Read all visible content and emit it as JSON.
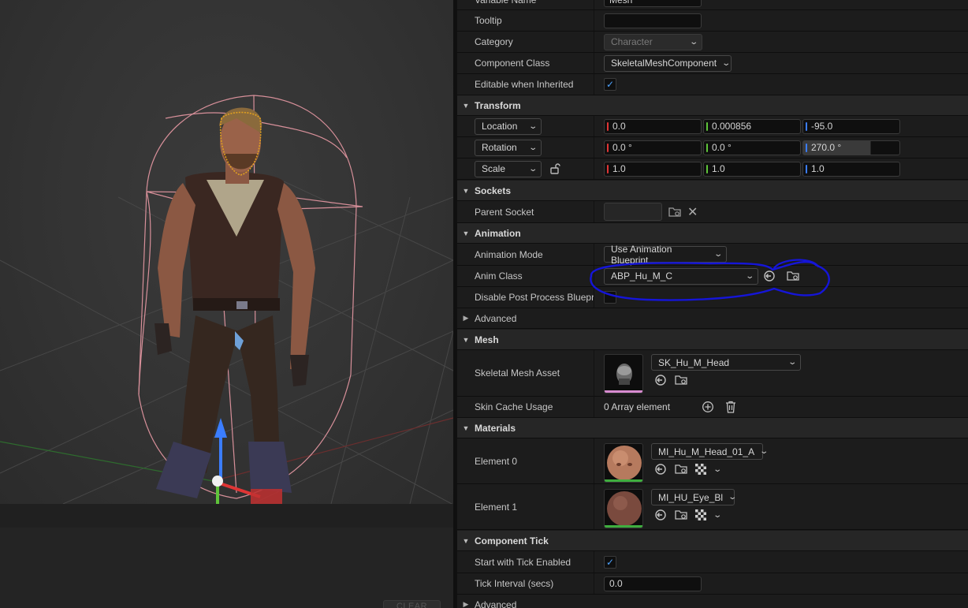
{
  "details": {
    "variable_name": {
      "label": "Variable Name",
      "value": "Mesh"
    },
    "tooltip": {
      "label": "Tooltip",
      "value": ""
    },
    "category": {
      "label": "Category",
      "value": "Character"
    },
    "component_class": {
      "label": "Component Class",
      "value": "SkeletalMeshComponent"
    },
    "editable_inherited": {
      "label": "Editable when Inherited",
      "checked": true
    },
    "transform": {
      "title": "Transform",
      "location": {
        "mode": "Location",
        "x": "0.0",
        "y": "0.000856",
        "z": "-95.0"
      },
      "rotation": {
        "mode": "Rotation",
        "x": "0.0 °",
        "y": "0.0 °",
        "z": "270.0 °"
      },
      "scale": {
        "mode": "Scale",
        "x": "1.0",
        "y": "1.0",
        "z": "1.0"
      }
    },
    "sockets": {
      "title": "Sockets",
      "parent_socket": {
        "label": "Parent Socket",
        "value": ""
      }
    },
    "animation": {
      "title": "Animation",
      "mode": {
        "label": "Animation Mode",
        "value": "Use Animation Blueprint"
      },
      "anim_class": {
        "label": "Anim Class",
        "value": "ABP_Hu_M_C"
      },
      "disable_post": {
        "label": "Disable Post Process Bluepr...",
        "checked": false
      },
      "advanced": "Advanced"
    },
    "mesh": {
      "title": "Mesh",
      "asset": {
        "label": "Skeletal Mesh Asset",
        "value": "SK_Hu_M_Head"
      },
      "skin_cache": {
        "label": "Skin Cache Usage",
        "value": "0 Array element"
      }
    },
    "materials": {
      "title": "Materials",
      "element0": {
        "label": "Element 0",
        "value": "MI_Hu_M_Head_01_A"
      },
      "element1": {
        "label": "Element 1",
        "value": "MI_HU_Eye_Bl"
      }
    },
    "tick": {
      "title": "Component Tick",
      "start_enabled": {
        "label": "Start with Tick Enabled",
        "checked": true
      },
      "interval": {
        "label": "Tick Interval (secs)",
        "value": "0.0"
      },
      "advanced": "Advanced"
    }
  },
  "log": {
    "clear_label": "CLEAR"
  },
  "colors": {
    "x_axis": "#e03535",
    "y_axis": "#5fc43a",
    "z_axis": "#3b7dff",
    "annotation": "#1515d8",
    "check": "#4da3ff"
  }
}
